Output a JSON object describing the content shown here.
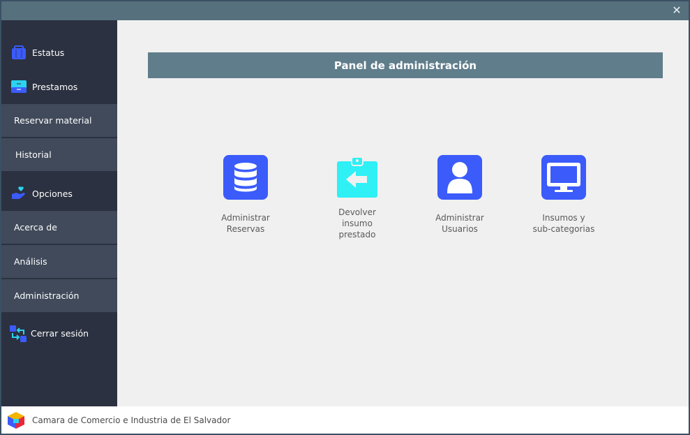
{
  "window": {
    "close_glyph": "✕"
  },
  "sidebar": {
    "estatus": "Estatus",
    "prestamos": "Prestamos",
    "reservar": "Reservar material",
    "historial": "Historial",
    "opciones": "Opciones",
    "acerca": "Acerca de",
    "analisis": "Análisis",
    "administracion": "Administración",
    "cerrar": "Cerrar sesión"
  },
  "main": {
    "title": "Panel de administración",
    "tiles": [
      {
        "label": "Administrar\nReservas",
        "icon": "database-icon",
        "color": "#3b5bfb"
      },
      {
        "label": "Devolver\ninsumo\nprestado",
        "icon": "clipboard-return-icon",
        "color": "#2ef0f5"
      },
      {
        "label": "Administrar\nUsuarios",
        "icon": "user-icon",
        "color": "#3b5bfb"
      },
      {
        "label": "Insumos y\nsub-categorias",
        "icon": "monitor-icon",
        "color": "#3b5bfb"
      }
    ]
  },
  "footer": {
    "text": "Camara de Comercio e Industria de El Salvador"
  },
  "colors": {
    "titlebar": "#56707d",
    "sidebar": "#2b3140",
    "sidebar_sub": "#404a5a",
    "panel_header": "#607d8b",
    "accent_blue": "#3b5bfb",
    "accent_cyan": "#2ef0f5"
  }
}
